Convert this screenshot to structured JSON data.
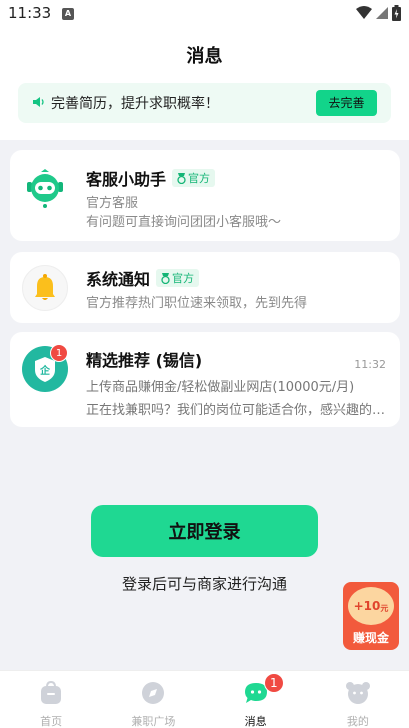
{
  "status_bar": {
    "time": "11:33",
    "notification_letter": "A"
  },
  "page": {
    "title": "消息"
  },
  "banner": {
    "text": "完善简历，提升求职概率！",
    "button_label": "去完善"
  },
  "conversations": [
    {
      "name": "客服小助手",
      "badge": "官方",
      "line1": "官方客服",
      "line2": "有问题可直接询问团团小客服哦～"
    },
    {
      "name": "系统通知",
      "badge": "官方",
      "line1": "官方推荐热门职位速来领取，先到先得"
    },
    {
      "name": "精选推荐 (锡信)",
      "unread": "1",
      "time": "11:32",
      "line1": "上传商品赚佣金/轻松做副业网店(10000元/月)",
      "line2": "正在找兼职吗？我们的岗位可能适合你，感兴趣的话可以聊聊"
    }
  ],
  "login": {
    "button_label": "立即登录",
    "hint": "登录后可与商家进行沟通"
  },
  "float_widget": {
    "amount": "+10",
    "unit": "元",
    "label": "赚现金"
  },
  "tabbar": {
    "items": [
      {
        "label": "首页"
      },
      {
        "label": "兼职广场"
      },
      {
        "label": "消息",
        "badge": "1"
      },
      {
        "label": "我的"
      }
    ]
  },
  "colors": {
    "accent": "#1fd892",
    "badge": "#f04a42",
    "official": "#14b576"
  }
}
